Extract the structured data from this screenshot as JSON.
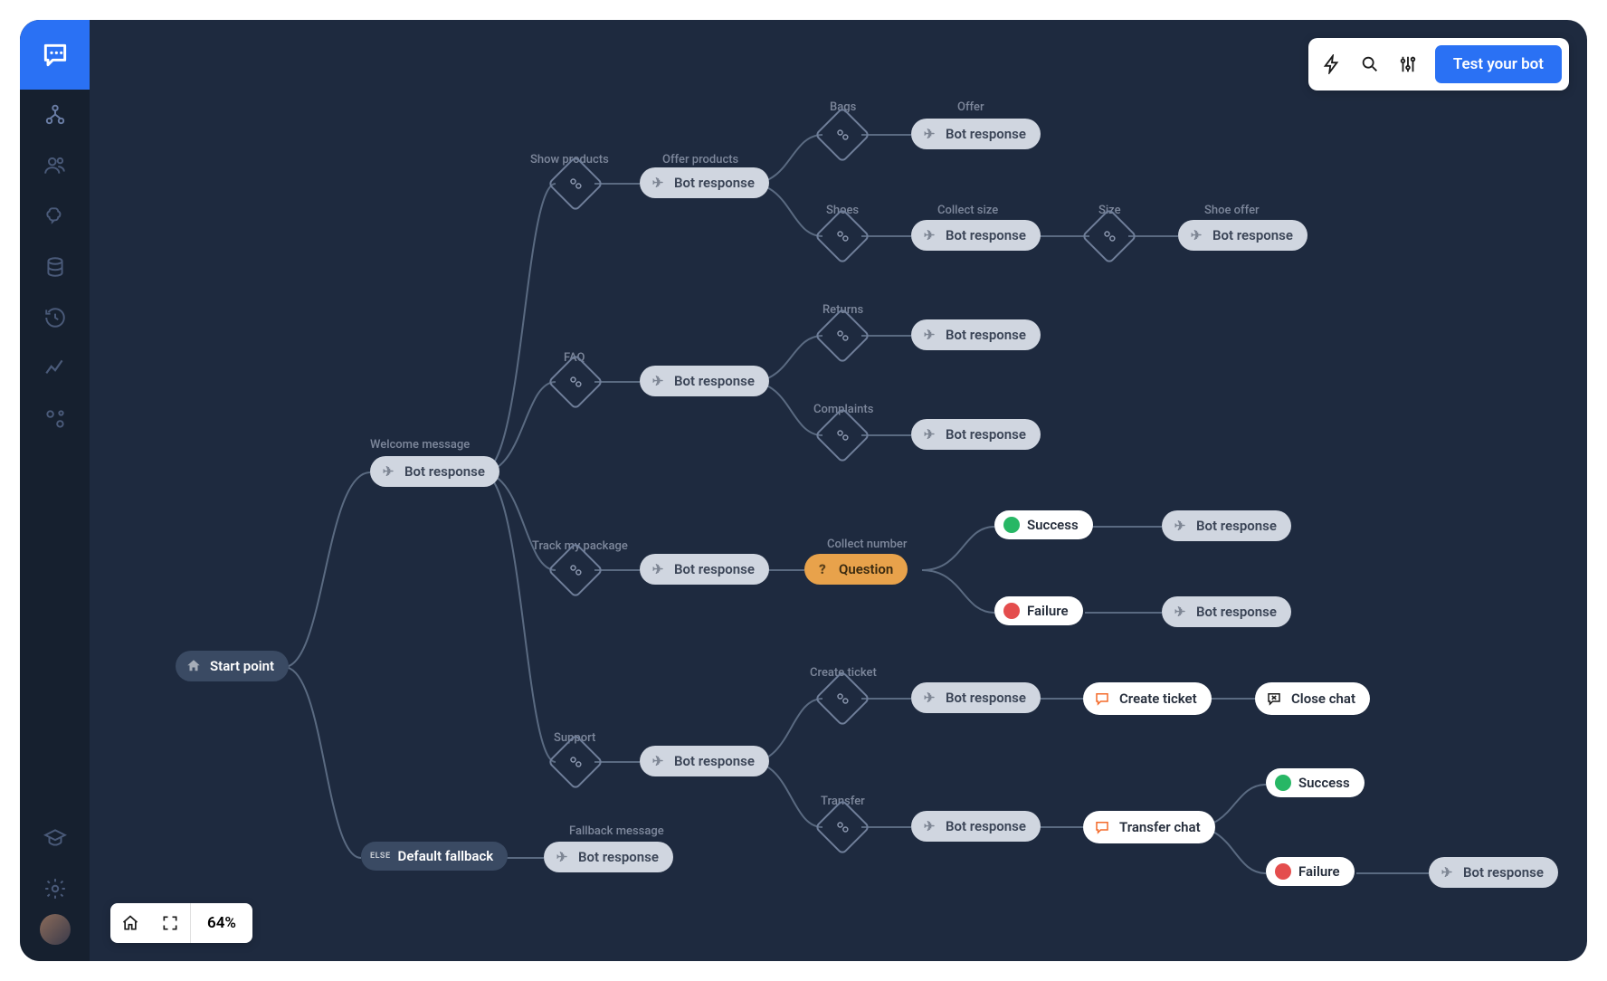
{
  "toolbar": {
    "test_label": "Test your bot"
  },
  "zoom": {
    "value": "64%"
  },
  "labels": {
    "start": "Start point",
    "welcome": "Welcome message",
    "bot_response": "Bot response",
    "default_fallback": "Default fallback",
    "else": "ELSE",
    "show_products": "Show products",
    "offer_products": "Offer products",
    "faq": "FAQ",
    "track_pkg": "Track my package",
    "support": "Support",
    "fallback_msg": "Fallback message",
    "bags": "Bags",
    "offer": "Offer",
    "shoes": "Shoes",
    "collect_size": "Collect size",
    "size": "Size",
    "shoe_offer": "Shoe offer",
    "returns": "Returns",
    "complaints": "Complaints",
    "collect_number": "Collect number",
    "question": "Question",
    "success": "Success",
    "failure": "Failure",
    "create_ticket_grp": "Create ticket",
    "create_ticket": "Create ticket",
    "close_chat": "Close chat",
    "transfer_grp": "Transfer",
    "transfer_chat": "Transfer chat"
  }
}
